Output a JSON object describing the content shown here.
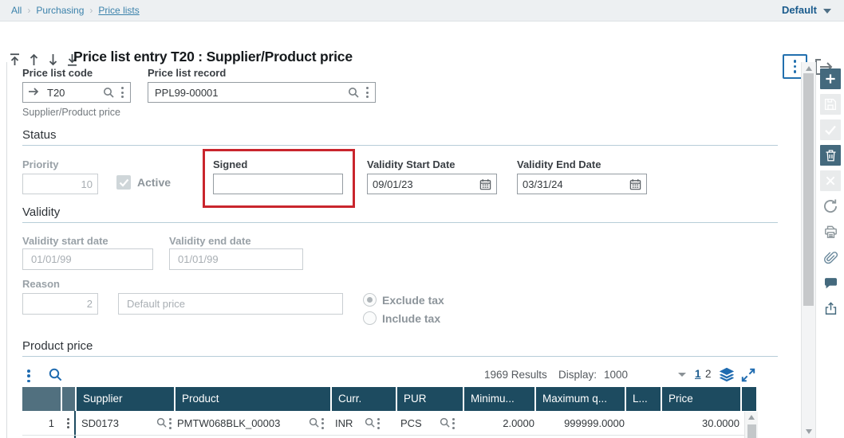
{
  "topbar": {
    "breadcrumbs": [
      "All",
      "Purchasing",
      "Price lists"
    ],
    "workspace": "Default"
  },
  "header": {
    "title": "Price list entry T20 : Supplier/Product price"
  },
  "identity": {
    "price_list_code_label": "Price list code",
    "price_list_code": "T20",
    "price_list_type": "Supplier/Product price",
    "price_list_record_label": "Price list record",
    "price_list_record": "PPL99-00001"
  },
  "status": {
    "title": "Status",
    "priority_label": "Priority",
    "priority": "10",
    "active_label": "Active",
    "signed_label": "Signed",
    "signed_value": "",
    "validity_start_label": "Validity Start Date",
    "validity_start": "09/01/23",
    "validity_end_label": "Validity End Date",
    "validity_end": "03/31/24"
  },
  "validity": {
    "title": "Validity",
    "start_label": "Validity start date",
    "start": "01/01/99",
    "end_label": "Validity end date",
    "end": "01/01/99",
    "reason_label": "Reason",
    "reason_code": "2",
    "reason_text": "Default price",
    "tax_exclude_label": "Exclude tax",
    "tax_include_label": "Include tax"
  },
  "product_price": {
    "title": "Product price",
    "results": "1969 Results",
    "display_label": "Display:",
    "display_value": "1000",
    "page_1": "1",
    "page_2": "2",
    "columns": [
      "Supplier",
      "Product",
      "Curr.",
      "PUR",
      "Minimu...",
      "Maximum q...",
      "L...",
      "Price"
    ],
    "row": {
      "num": "1",
      "supplier": "SD0173",
      "product": "PMTW068BLK_00003",
      "currency": "INR",
      "unit": "PCS",
      "min_qty": "2.0000",
      "max_qty": "999999.0000",
      "landed": "",
      "price": "30.0000"
    }
  },
  "colors": {
    "accent_blue": "#1f6bb0",
    "table_header_dark": "#1d4b60",
    "table_header_light": "#51707f",
    "toolbar_slate": "#44697d",
    "highlight_red": "#c9252d"
  }
}
